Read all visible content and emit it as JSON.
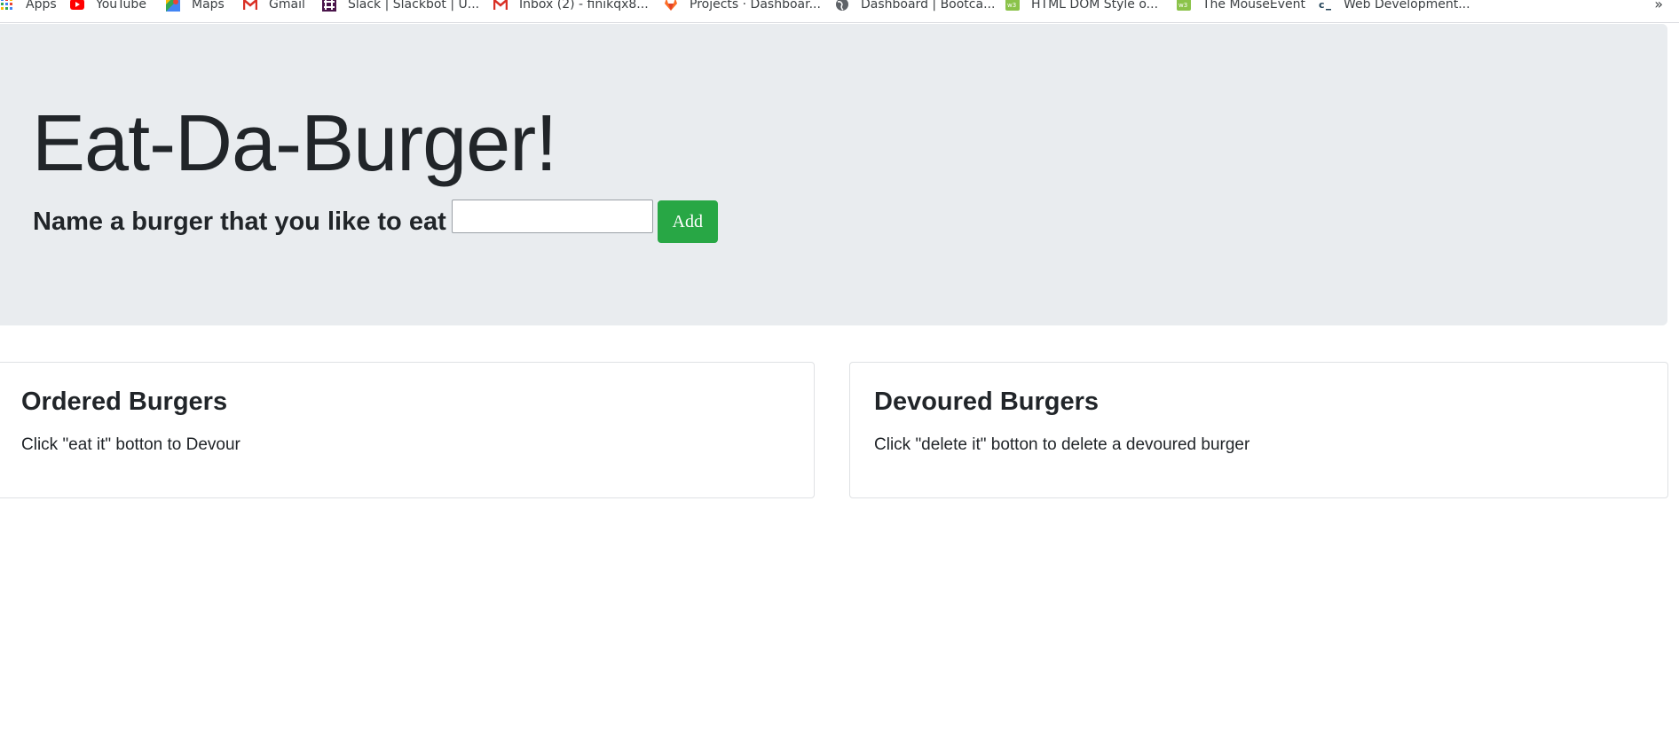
{
  "bookmarks": [
    {
      "label": "Apps",
      "icon": "apps-grid-icon"
    },
    {
      "label": "YouTube",
      "icon": "youtube-icon"
    },
    {
      "label": "Maps",
      "icon": "maps-icon"
    },
    {
      "label": "Gmail",
      "icon": "gmail-icon"
    },
    {
      "label": "Slack | Slackbot | U...",
      "icon": "slack-icon"
    },
    {
      "label": "Inbox (2) - finikqx8...",
      "icon": "gmail-icon"
    },
    {
      "label": "Projects · Dashboar...",
      "icon": "gitlab-icon"
    },
    {
      "label": "Dashboard | Bootca...",
      "icon": "globe-icon"
    },
    {
      "label": "HTML DOM Style o...",
      "icon": "w3schools-icon"
    },
    {
      "label": "The MouseEvent",
      "icon": "w3schools-icon"
    },
    {
      "label": "Web Development...",
      "icon": "codecademy-icon"
    }
  ],
  "bookmarks_overflow": "»",
  "header": {
    "title": "Eat-Da-Burger!",
    "form_label": "Name a burger that you like to eat",
    "input_value": "",
    "add_label": "Add"
  },
  "ordered": {
    "title": "Ordered Burgers",
    "instructions": "Click \"eat it\" botton to Devour"
  },
  "devoured": {
    "title": "Devoured Burgers",
    "instructions": "Click \"delete it\" botton to delete a devoured burger"
  },
  "colors": {
    "jumbotron_bg": "#e9ecef",
    "add_button": "#28a745",
    "text": "#212529"
  }
}
